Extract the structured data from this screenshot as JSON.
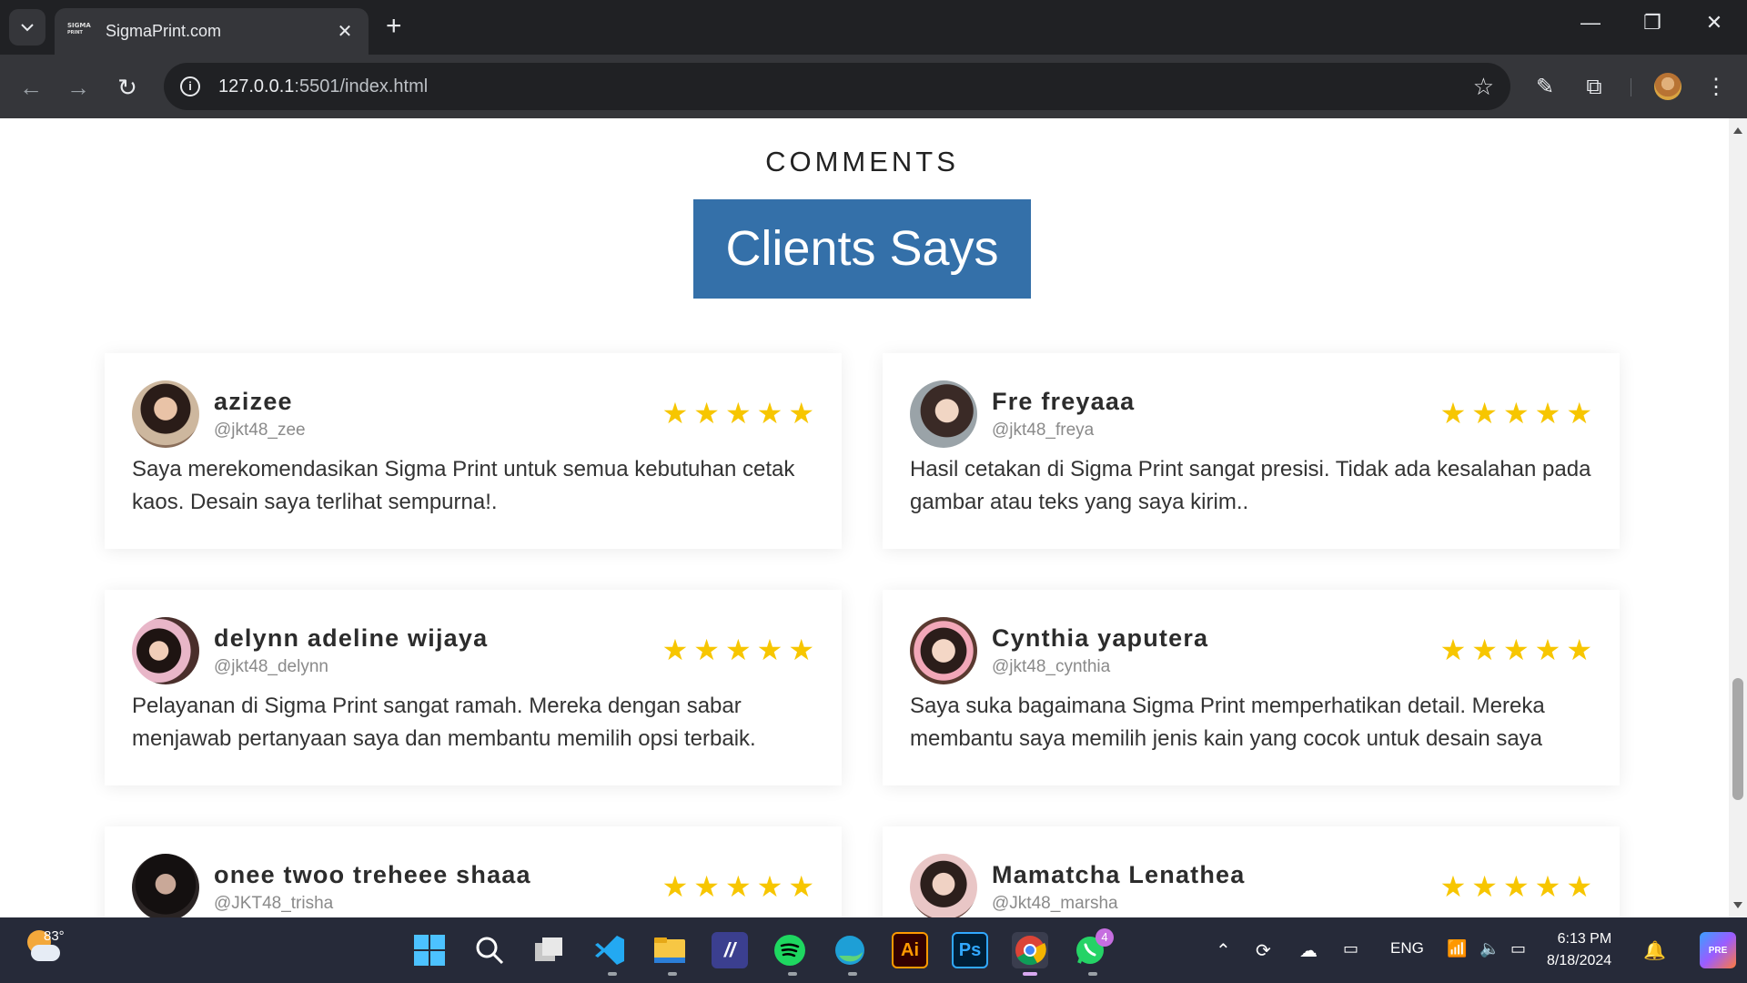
{
  "browser": {
    "tab_title": "SigmaPrint.com",
    "favicon_text_top": "SIGMA",
    "favicon_text_bottom": "PRINT",
    "url_host": "127.0.0.1",
    "url_rest": ":5501/index.html"
  },
  "page": {
    "eyebrow": "COMMENTS",
    "banner": "Clients Says",
    "star_color": "#f7c600",
    "banner_color": "#3470a9"
  },
  "comments": [
    {
      "name": "azizee",
      "handle": "@jkt48_zee",
      "rating": 5,
      "text": "Saya merekomendasikan Sigma Print untuk semua kebutuhan cetak kaos. Desain saya terlihat sempurna!."
    },
    {
      "name": "Fre freyaaa",
      "handle": "@jkt48_freya",
      "rating": 5,
      "text": "Hasil cetakan di Sigma Print sangat presisi. Tidak ada kesalahan pada gambar atau teks yang saya kirim.."
    },
    {
      "name": "delynn adeline wijaya",
      "handle": "@jkt48_delynn",
      "rating": 5,
      "text": "Pelayanan di Sigma Print sangat ramah. Mereka dengan sabar menjawab pertanyaan saya dan membantu memilih opsi terbaik."
    },
    {
      "name": "Cynthia yaputera",
      "handle": "@jkt48_cynthia",
      "rating": 5,
      "text": "Saya suka bagaimana Sigma Print memperhatikan detail. Mereka membantu saya memilih jenis kain yang cocok untuk desain saya"
    },
    {
      "name": "onee twoo treheee shaaa",
      "handle": "@JKT48_trisha",
      "rating": 5,
      "text": ""
    },
    {
      "name": "Mamatcha Lenathea",
      "handle": "@Jkt48_marsha",
      "rating": 5,
      "text": ""
    }
  ],
  "taskbar": {
    "temperature": "83°",
    "whatsapp_badge": "4",
    "language": "ENG",
    "time": "6:13 PM",
    "date": "8/18/2024"
  }
}
